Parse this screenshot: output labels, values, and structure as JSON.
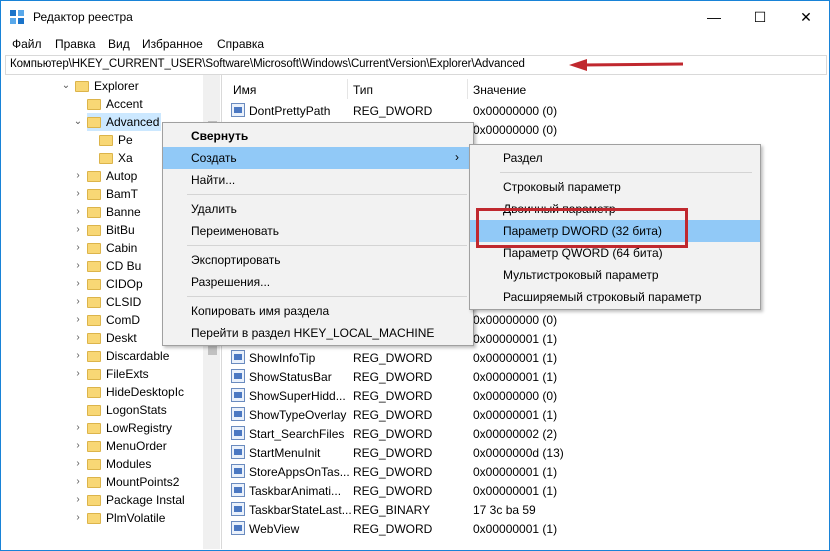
{
  "window": {
    "title": "Редактор реестра",
    "minimize_glyph": "—",
    "maximize_glyph": "☐",
    "close_glyph": "✕"
  },
  "menu": [
    "Файл",
    "Правка",
    "Вид",
    "Избранное",
    "Справка"
  ],
  "address": "Компьютер\\HKEY_CURRENT_USER\\Software\\Microsoft\\Windows\\CurrentVersion\\Explorer\\Advanced",
  "tree": {
    "items": [
      {
        "label": "Explorer",
        "chev": "⌄"
      },
      {
        "label": "Accent",
        "chev": ""
      },
      {
        "label": "Advanced",
        "chev": "⌄",
        "selected": true
      },
      {
        "label": "Pe",
        "chev": ""
      },
      {
        "label": "Xa",
        "chev": ""
      },
      {
        "label": "Autop",
        "chev": "›"
      },
      {
        "label": "BamT",
        "chev": "›"
      },
      {
        "label": "Banne",
        "chev": "›"
      },
      {
        "label": "BitBu",
        "chev": "›"
      },
      {
        "label": "Cabin",
        "chev": "›"
      },
      {
        "label": "CD Bu",
        "chev": "›"
      },
      {
        "label": "CIDOp",
        "chev": "›"
      },
      {
        "label": "CLSID",
        "chev": "›"
      },
      {
        "label": "ComD",
        "chev": "›"
      },
      {
        "label": "Deskt",
        "chev": "›"
      },
      {
        "label": "Discardable",
        "chev": "›"
      },
      {
        "label": "FileExts",
        "chev": "›"
      },
      {
        "label": "HideDesktopIc",
        "chev": ""
      },
      {
        "label": "LogonStats",
        "chev": ""
      },
      {
        "label": "LowRegistry",
        "chev": "›"
      },
      {
        "label": "MenuOrder",
        "chev": "›"
      },
      {
        "label": "Modules",
        "chev": "›"
      },
      {
        "label": "MountPoints2",
        "chev": "›"
      },
      {
        "label": "Package Instal",
        "chev": "›"
      },
      {
        "label": "PlmVolatile",
        "chev": "›"
      }
    ]
  },
  "columns": {
    "name": "Имя",
    "type": "Тип",
    "value": "Значение"
  },
  "rows_top": [
    {
      "name": "DontPrettyPath",
      "type": "REG_DWORD",
      "value": "0x00000000 (0)"
    },
    {
      "name": "",
      "type": "",
      "value": "0x00000000 (0)"
    }
  ],
  "rows_mid": [
    {
      "name": "",
      "type": "",
      "value": "0x00000000 (0)"
    },
    {
      "name": "",
      "type": "",
      "value": "0x00000001 (1)"
    }
  ],
  "rows": [
    {
      "name": "ShowInfoTip",
      "type": "REG_DWORD",
      "value": "0x00000001 (1)"
    },
    {
      "name": "ShowStatusBar",
      "type": "REG_DWORD",
      "value": "0x00000001 (1)"
    },
    {
      "name": "ShowSuperHidd...",
      "type": "REG_DWORD",
      "value": "0x00000000 (0)"
    },
    {
      "name": "ShowTypeOverlay",
      "type": "REG_DWORD",
      "value": "0x00000001 (1)"
    },
    {
      "name": "Start_SearchFiles",
      "type": "REG_DWORD",
      "value": "0x00000002 (2)"
    },
    {
      "name": "StartMenuInit",
      "type": "REG_DWORD",
      "value": "0x0000000d (13)"
    },
    {
      "name": "StoreAppsOnTas...",
      "type": "REG_DWORD",
      "value": "0x00000001 (1)"
    },
    {
      "name": "TaskbarAnimati...",
      "type": "REG_DWORD",
      "value": "0x00000001 (1)"
    },
    {
      "name": "TaskbarStateLast...",
      "type": "REG_BINARY",
      "value": "17 3c ba 59"
    },
    {
      "name": "WebView",
      "type": "REG_DWORD",
      "value": "0x00000001 (1)"
    }
  ],
  "context_menu": {
    "collapse": "Свернуть",
    "create": "Создать",
    "create_arrow": "›",
    "find": "Найти...",
    "delete": "Удалить",
    "rename": "Переименовать",
    "export": "Экспортировать",
    "permissions": "Разрешения...",
    "copy_key_name": "Копировать имя раздела",
    "goto_hklm": "Перейти в раздел HKEY_LOCAL_MACHINE"
  },
  "submenu": {
    "key": "Раздел",
    "string": "Строковый параметр",
    "binary": "Двоичный параметр",
    "dword": "Параметр DWORD (32 бита)",
    "qword": "Параметр QWORD (64 бита)",
    "multistring": "Мультистроковый параметр",
    "expandstring": "Расширяемый строковый параметр"
  },
  "colors": {
    "highlight": "#91c9f7",
    "annotation_red": "#c0282e",
    "window_border": "#1883d7"
  }
}
